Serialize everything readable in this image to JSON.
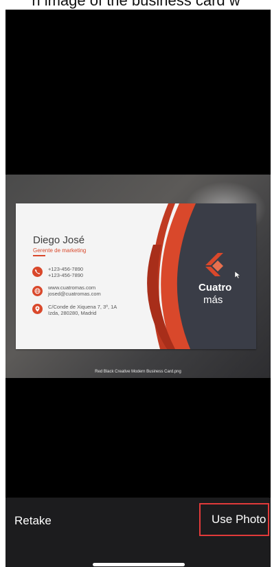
{
  "top_caption": "n image of the business card w",
  "card": {
    "name": "Diego José",
    "role": "Gerente de marketing",
    "phone_lines": [
      "+123-456-7890",
      "+123-456-7890"
    ],
    "web_lines": [
      "www.cuatromas.com",
      "josed@cuatromas.com"
    ],
    "address_lines": [
      "C/Conde de Xiquena 7, 3º, 1A",
      "Izda, 280280, Madrid"
    ],
    "logo_line1": "Cuatro",
    "logo_line2": "más"
  },
  "photo_filename": "Red Black Creative Modern Business Card.png",
  "toolbar": {
    "retake_label": "Retake",
    "use_photo_label": "Use Photo"
  },
  "colors": {
    "accent_red": "#d9482b",
    "highlight_border": "#e23a3a",
    "card_dark": "#3a3d47",
    "toolbar_bg": "#1c1c1e"
  },
  "icons": [
    "phone-icon",
    "globe-icon",
    "location-pin-icon",
    "logo-chevron-icon",
    "home-indicator"
  ]
}
